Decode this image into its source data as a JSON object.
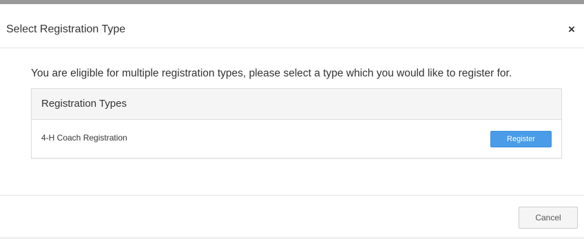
{
  "modal": {
    "title": "Select Registration Type",
    "close_label": "×",
    "intro": "You are eligible for multiple registration types, please select a type which you would like to register for.",
    "panel": {
      "heading": "Registration Types",
      "rows": [
        {
          "label": "4-H Coach Registration",
          "button_label": "Register"
        }
      ]
    },
    "footer": {
      "cancel_label": "Cancel"
    }
  },
  "colors": {
    "topbar": "#9a9a9a",
    "register_button": "#4a9ce8",
    "panel_heading_bg": "#f5f5f5"
  },
  "icons": {
    "close": "close-icon"
  }
}
